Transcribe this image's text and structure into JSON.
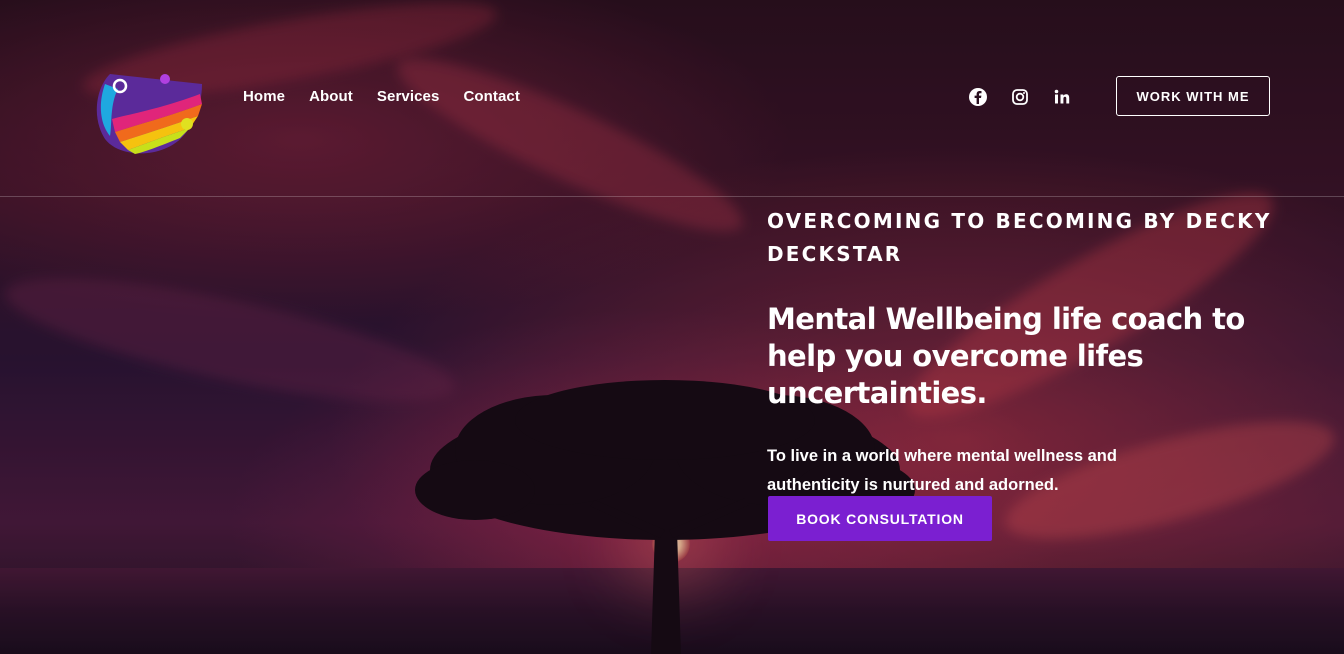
{
  "nav": {
    "items": [
      {
        "label": "Home"
      },
      {
        "label": "About"
      },
      {
        "label": "Services"
      },
      {
        "label": "Contact"
      }
    ]
  },
  "social": {
    "icons": [
      "facebook-icon",
      "instagram-icon",
      "linkedin-icon"
    ]
  },
  "header": {
    "cta_label": "WORK WITH ME"
  },
  "hero": {
    "eyebrow": "OVERCOMING TO BECOMING BY DECKY DECKSTAR",
    "headline": "Mental Wellbeing life coach to help you overcome lifes uncertainties.",
    "subtext": "To live in a world where mental wellness and authenticity is nurtured and adorned.",
    "button_label": "BOOK CONSULTATION"
  },
  "colors": {
    "accent": "#7b1fd1",
    "text": "#ffffff"
  }
}
